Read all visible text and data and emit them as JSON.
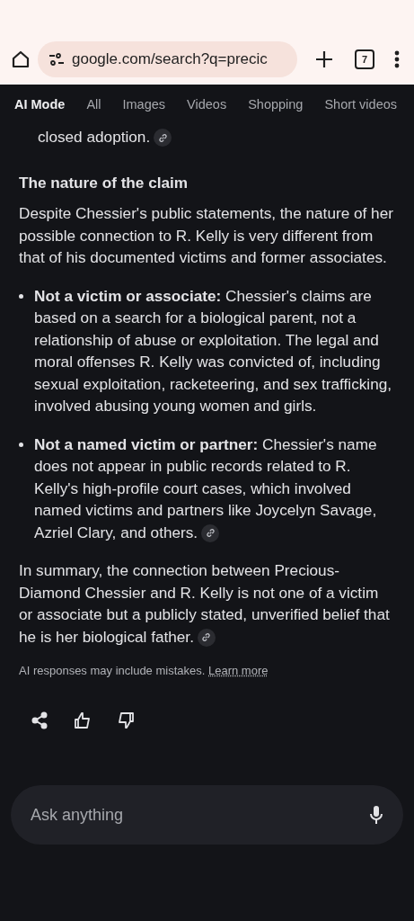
{
  "browser": {
    "url": "google.com/search?q=precic",
    "tab_count": "7"
  },
  "tabs": [
    {
      "label": "AI Mode",
      "selected": true
    },
    {
      "label": "All",
      "selected": false
    },
    {
      "label": "Images",
      "selected": false
    },
    {
      "label": "Videos",
      "selected": false
    },
    {
      "label": "Shopping",
      "selected": false
    },
    {
      "label": "Short videos",
      "selected": false
    }
  ],
  "blocks": [
    {
      "kind": "continuation",
      "text": "closed adoption.",
      "link": true
    },
    {
      "kind": "heading",
      "text": "The nature of the claim",
      "link": false
    },
    {
      "kind": "paragraph",
      "text": "Despite Chessier's public statements, the nature of her possible connection to R. Kelly is very different from that of his documented victims and former associates.",
      "link": false
    },
    {
      "kind": "bullet",
      "text": "**Not a victim or associate:** Chessier's claims are based on a search for a biological parent, not a relationship of abuse or exploitation. The legal and moral offenses R. Kelly was convicted of, including sexual exploitation, racketeering, and sex trafficking, involved abusing young women and girls.",
      "link": false
    },
    {
      "kind": "bullet",
      "text": "**Not a named victim or partner:** Chessier's name does not appear in public records related to R. Kelly's high-profile court cases, which involved named victims and partners like Joycelyn Savage, Azriel Clary, and others.",
      "link": true
    },
    {
      "kind": "paragraph",
      "text": "In summary, the connection between Precious-Diamond Chessier and R. Kelly is not one of a victim or associate but a publicly stated, unverified belief that he is her biological father.",
      "link": true
    }
  ],
  "disclaimer": {
    "text": "AI responses may include mistakes.",
    "link": "Learn more"
  },
  "ask": {
    "placeholder": "Ask anything"
  }
}
